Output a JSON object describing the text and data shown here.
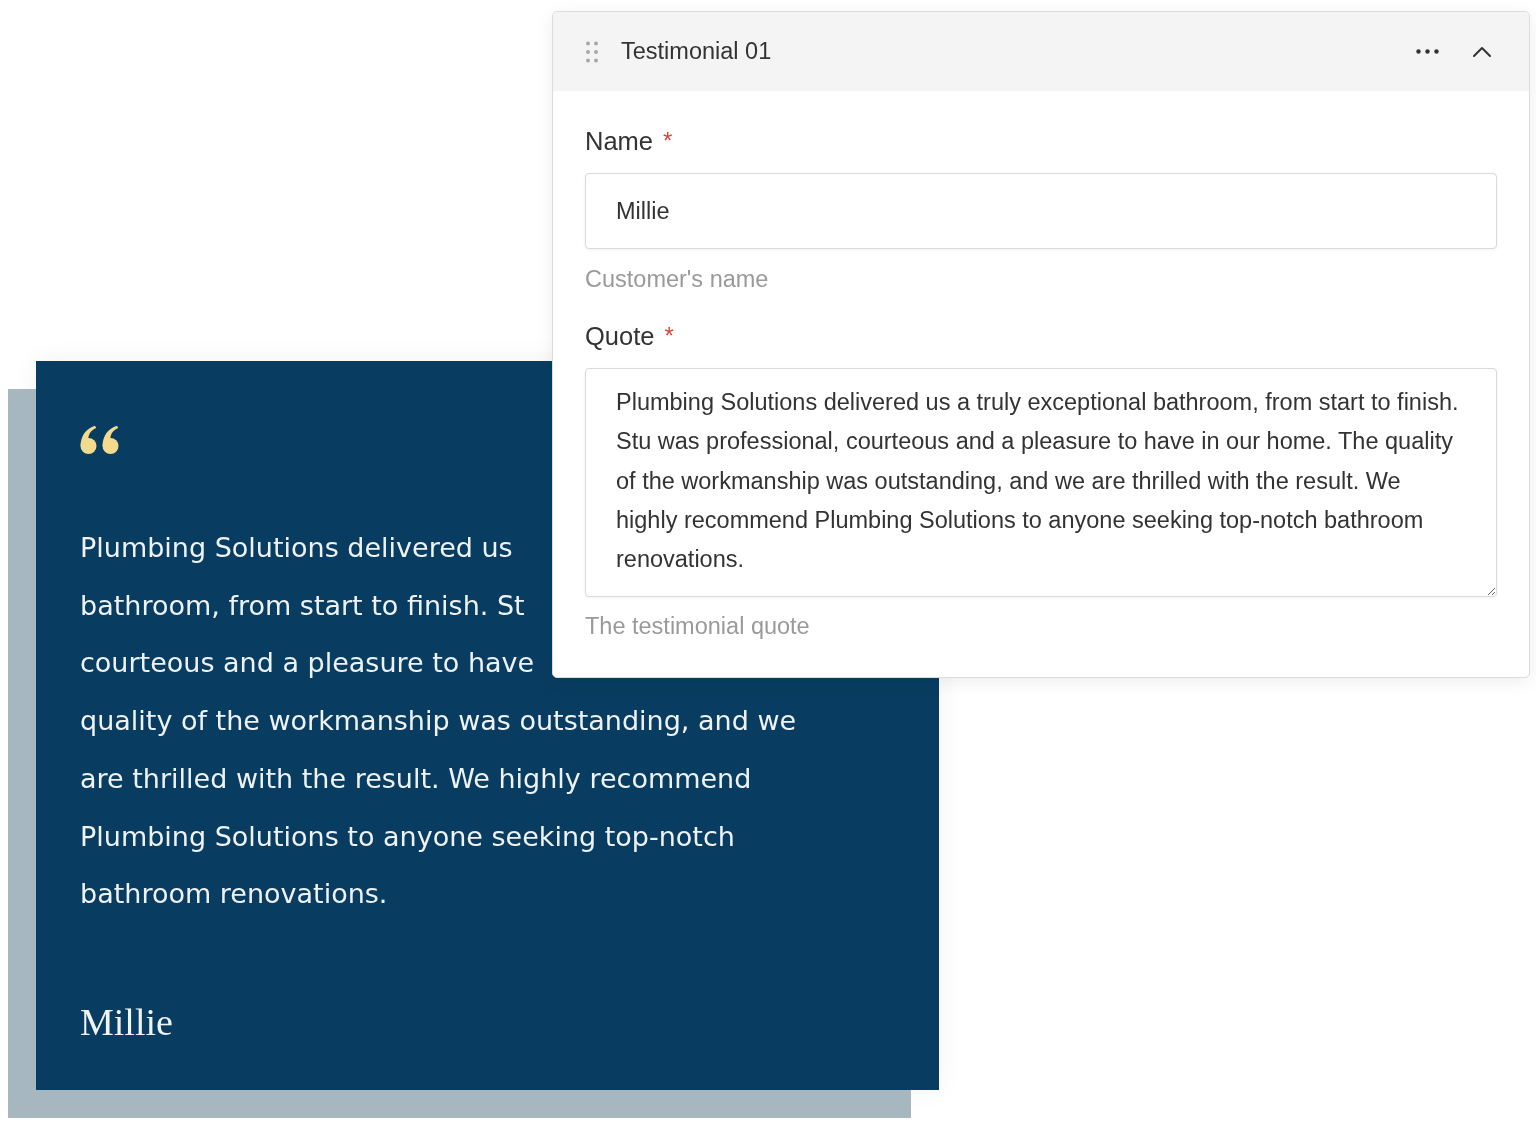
{
  "editor_panel": {
    "title": "Testimonial 01",
    "expanded": true,
    "fields": [
      {
        "kind": "input",
        "label": "Name",
        "required_mark": "*",
        "value": "Millie",
        "help": "Customer's name"
      },
      {
        "kind": "textarea",
        "label": "Quote",
        "required_mark": "*",
        "value": "Plumbing Solutions delivered us a truly exceptional bathroom, from start to finish. Stu was professional, courteous and a pleasure to have in our home. The quality of the workmanship was outstanding, and we are thrilled with the result. We highly recommend Plumbing Solutions to anyone seeking top-notch bathroom renovations.",
        "help": "The testimonial quote"
      }
    ]
  },
  "testimonial_card": {
    "quote_lines": [
      "Plumbing Solutions delivered us",
      "bathroom, from start to finish. St",
      "courteous and a pleasure to have",
      "quality of the workmanship was outstanding, and we",
      "are thrilled with the result. We highly recommend",
      "Plumbing Solutions to anyone seeking top-notch",
      "bathroom renovations."
    ],
    "author": "Millie"
  }
}
